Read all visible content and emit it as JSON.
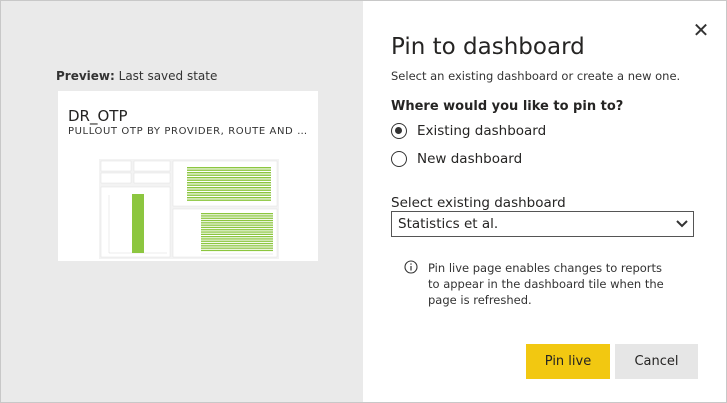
{
  "preview": {
    "label_bold": "Preview:",
    "label_rest": " Last saved state",
    "card_title": "DR_OTP",
    "card_subtitle": "PULLOUT OTP BY PROVIDER, ROUTE AND DIRECTION"
  },
  "dialog": {
    "close_glyph": "✕",
    "title": "Pin to dashboard",
    "subtitle": "Select an existing dashboard or create a new one.",
    "question": "Where would you like to pin to?"
  },
  "options": [
    {
      "label": "Existing dashboard",
      "checked": true
    },
    {
      "label": "New dashboard",
      "checked": false
    }
  ],
  "select": {
    "label": "Select existing dashboard",
    "value": "Statistics et al."
  },
  "info": {
    "text": "Pin live page enables changes to reports to appear in the dashboard tile when the page is refreshed."
  },
  "buttons": {
    "primary": "Pin live",
    "secondary": "Cancel"
  },
  "colors": {
    "primary_button": "#f2c811",
    "chart_bars": "#8cc63f",
    "preview_background": "#eaeaea"
  }
}
